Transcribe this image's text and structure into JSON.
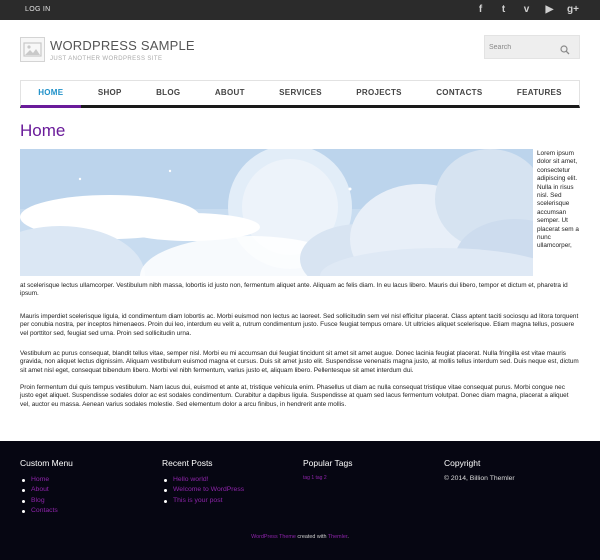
{
  "topbar": {
    "login_label": "LOG IN",
    "social": [
      {
        "icon": "facebook-icon",
        "glyph": "f"
      },
      {
        "icon": "twitter-icon",
        "glyph": "t"
      },
      {
        "icon": "vimeo-icon",
        "glyph": "v"
      },
      {
        "icon": "youtube-icon",
        "glyph": "▶"
      },
      {
        "icon": "google-plus-icon",
        "glyph": "g+"
      }
    ]
  },
  "header": {
    "title": "WORDPRESS SAMPLE",
    "description": "JUST ANOTHER WORDPRESS SITE",
    "logo_icon": "image-placeholder-icon",
    "search_placeholder": "Search"
  },
  "nav": {
    "items": [
      "HOME",
      "SHOP",
      "BLOG",
      "ABOUT",
      "SERVICES",
      "PROJECTS",
      "CONTACTS",
      "FEATURES"
    ],
    "active": "HOME"
  },
  "content": {
    "title": "Home",
    "side_text": "Lorem ipsum dolor sit amet, consectetur adipiscing elit. Nulla in risus nisl. Sed scelerisque accumsan semper. Ut placerat sem a nunc ullamcorper,",
    "p1_tail": "at scelerisque lectus ullamcorper. Vestibulum nibh massa, lobortis id justo non, fermentum aliquet ante. Aliquam ac felis diam. In eu lacus libero. Mauris dui libero, tempor et dictum et, pharetra id ipsum.",
    "p2": "Mauris imperdiet scelerisque ligula, id condimentum diam lobortis ac. Morbi euismod non lectus ac laoreet. Sed sollicitudin sem vel nisl efficitur placerat. Class aptent taciti sociosqu ad litora torquent per conubia nostra, per inceptos himenaeos. Proin dui leo, interdum eu velit a, rutrum condimentum justo. Fusce feugiat tempus ornare. Ut ultricies aliquet scelerisque. Etiam magna tellus, posuere vel porttitor sed, feugiat sed urna. Proin sed sollicitudin urna.",
    "p3": "Vestibulum ac purus consequat, blandit tellus vitae, semper nisl. Morbi eu mi accumsan dui feugiat tincidunt sit amet sit amet augue. Donec lacinia feugiat placerat. Nulla fringilla est vitae mauris gravida, non aliquet lectus dignissim. Aliquam vestibulum euismod magna et cursus. Duis sit amet justo elit. Suspendisse venenatis magna justo, at mollis tellus interdum sed. Duis neque est, dictum sit amet nisl eget, consequat bibendum libero. Morbi vel nibh fermentum, varius justo et, aliquam libero. Pellentesque sit amet interdum dui.",
    "p4": "Proin fermentum dui quis tempus vestibulum. Nam lacus dui, euismod et ante at, tristique vehicula enim. Phasellus ut diam ac nulla consequat tristique vitae consequat purus. Morbi congue nec justo eget aliquet. Suspendisse sodales dolor ac est sodales condimentum. Curabitur a dapibus ligula. Suspendisse at quam sed lacus fermentum volutpat. Donec diam magna, placerat a aliquet vel, auctor eu massa. Aenean varius sodales molestie. Sed elementum dolor a arcu finibus, in hendrerit ante mollis."
  },
  "footer": {
    "custom_menu": {
      "title": "Custom Menu",
      "items": [
        "Home",
        "About",
        "Blog",
        "Contacts"
      ]
    },
    "recent_posts": {
      "title": "Recent Posts",
      "items": [
        "Hello world!",
        "Welcome to WordPress",
        "This is your post"
      ]
    },
    "popular_tags": {
      "title": "Popular Tags",
      "tags": "tag 1 tag 2"
    },
    "copyright": {
      "title": "Copyright",
      "text": "© 2014, Billion Themler"
    },
    "credit": {
      "link1": "WordPress Theme",
      "middle": " created with ",
      "link2": "Themler",
      "end": "."
    }
  },
  "colors": {
    "accent": "#6a1b9a",
    "link": "#8e24aa",
    "nav_active": "#1e90c8",
    "topbar": "#2b2b2b",
    "footer": "#060612"
  }
}
